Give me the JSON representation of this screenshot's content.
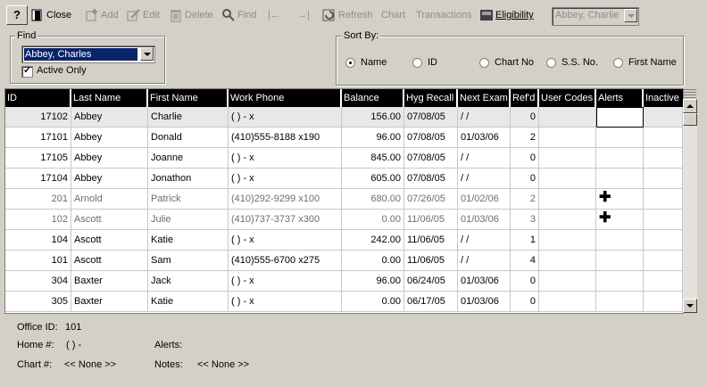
{
  "toolbar": {
    "help": "?",
    "close": "Close",
    "add": "Add",
    "edit": "Edit",
    "delete": "Delete",
    "find": "Find",
    "refresh": "Refresh",
    "chart": "Chart",
    "transactions": "Transactions",
    "eligibility": "Eligibility",
    "patient_combo": "Abbey, Charlie"
  },
  "find": {
    "title": "Find",
    "selected": "Abbey, Charles",
    "active_only_label": "Active Only",
    "active_only_checked": true
  },
  "sort": {
    "title": "Sort By:",
    "options": [
      {
        "label": "Name",
        "selected": true
      },
      {
        "label": "ID",
        "selected": false
      },
      {
        "label": "Chart No",
        "selected": false
      },
      {
        "label": "S.S. No.",
        "selected": false
      },
      {
        "label": "First Name",
        "selected": false
      }
    ]
  },
  "grid": {
    "columns": [
      "ID",
      "Last Name",
      "First Name",
      "Work Phone",
      "Balance",
      "Hyg Recall",
      "Next Exam",
      "Ref'd",
      "User Codes",
      "Alerts",
      "Inactive"
    ],
    "rows": [
      {
        "id": "17102",
        "last": "Abbey",
        "first": "Charlie",
        "phone": "( )  -    x",
        "balance": "156.00",
        "recall": "07/08/05",
        "exam": " / /",
        "refd": "0",
        "alert": false,
        "inactive_style": false
      },
      {
        "id": "17101",
        "last": "Abbey",
        "first": "Donald",
        "phone": "(410)555-8188 x190",
        "balance": "96.00",
        "recall": "07/08/05",
        "exam": "01/03/06",
        "refd": "2",
        "alert": false,
        "inactive_style": false
      },
      {
        "id": "17105",
        "last": "Abbey",
        "first": "Joanne",
        "phone": "( )  -    x",
        "balance": "845.00",
        "recall": "07/08/05",
        "exam": " / /",
        "refd": "0",
        "alert": false,
        "inactive_style": false
      },
      {
        "id": "17104",
        "last": "Abbey",
        "first": "Jonathon",
        "phone": "( )  -    x",
        "balance": "605.00",
        "recall": "07/08/05",
        "exam": " / /",
        "refd": "0",
        "alert": false,
        "inactive_style": false
      },
      {
        "id": "201",
        "last": "Arnold",
        "first": "Patrick",
        "phone": "(410)292-9299 x100",
        "balance": "680.00",
        "recall": "07/26/05",
        "exam": "01/02/06",
        "refd": "2",
        "alert": true,
        "inactive_style": true
      },
      {
        "id": "102",
        "last": "Ascott",
        "first": "Julie",
        "phone": "(410)737-3737 x300",
        "balance": "0.00",
        "recall": "11/06/05",
        "exam": "01/03/06",
        "refd": "3",
        "alert": true,
        "inactive_style": true
      },
      {
        "id": "104",
        "last": "Ascott",
        "first": "Katie",
        "phone": "( )  -    x",
        "balance": "242.00",
        "recall": "11/06/05",
        "exam": " / /",
        "refd": "1",
        "alert": false,
        "inactive_style": false
      },
      {
        "id": "101",
        "last": "Ascott",
        "first": "Sam",
        "phone": "(410)555-6700 x275",
        "balance": "0.00",
        "recall": "11/06/05",
        "exam": " / /",
        "refd": "4",
        "alert": false,
        "inactive_style": false
      },
      {
        "id": "304",
        "last": "Baxter",
        "first": "Jack",
        "phone": "( )  -    x",
        "balance": "96.00",
        "recall": "06/24/05",
        "exam": "01/03/06",
        "refd": "0",
        "alert": false,
        "inactive_style": false
      },
      {
        "id": "305",
        "last": "Baxter",
        "first": "Katie",
        "phone": "( )  -    x",
        "balance": "0.00",
        "recall": "06/17/05",
        "exam": "01/03/06",
        "refd": "0",
        "alert": false,
        "inactive_style": false
      }
    ]
  },
  "details": {
    "office_id_label": "Office ID:",
    "office_id": "101",
    "home_label": "Home #:",
    "home": "( )  -",
    "alerts_label": "Alerts:",
    "alerts": "",
    "chart_label": "Chart #:",
    "chart": "<< None >>",
    "notes_label": "Notes:",
    "notes": "<< None >>"
  },
  "icons": {
    "alert": "plus-cross-icon"
  }
}
